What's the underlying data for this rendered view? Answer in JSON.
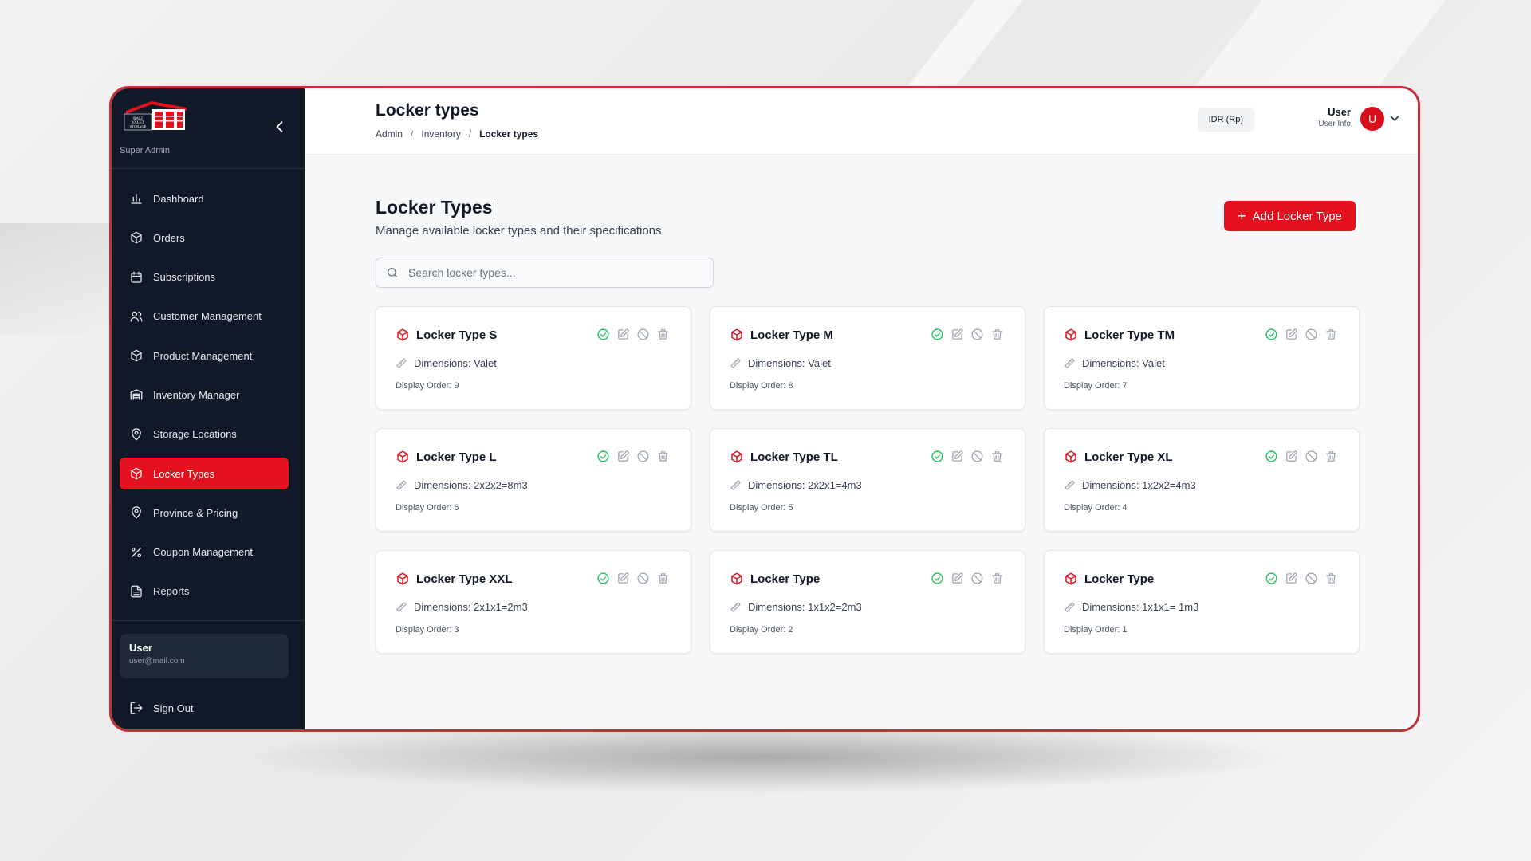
{
  "app": {
    "logo_text": "BALI VALET STORAGE",
    "role": "Super Admin"
  },
  "sidebar": {
    "items": [
      {
        "label": "Dashboard",
        "icon": "bar-chart-icon"
      },
      {
        "label": "Orders",
        "icon": "package-icon"
      },
      {
        "label": "Subscriptions",
        "icon": "calendar-icon"
      },
      {
        "label": "Customer Management",
        "icon": "users-icon"
      },
      {
        "label": "Product Management",
        "icon": "package-icon"
      },
      {
        "label": "Inventory Manager",
        "icon": "warehouse-icon"
      },
      {
        "label": "Storage Locations",
        "icon": "map-pin-icon"
      },
      {
        "label": "Locker Types",
        "icon": "package-icon"
      },
      {
        "label": "Province & Pricing",
        "icon": "map-pin-icon"
      },
      {
        "label": "Coupon Management",
        "icon": "percent-icon"
      },
      {
        "label": "Reports",
        "icon": "file-text-icon"
      }
    ],
    "active_index": 7,
    "user": {
      "name": "User",
      "email": "user@mail.com"
    },
    "signout_label": "Sign Out"
  },
  "header": {
    "title": "Locker types",
    "breadcrumb": [
      "Admin",
      "Inventory",
      "Locker types"
    ],
    "currency": "IDR (Rp)",
    "user_name": "User",
    "user_role": "User Info",
    "avatar_initial": "U"
  },
  "content": {
    "title": "Locker Types",
    "subtitle": "Manage available locker types and their specifications",
    "add_button_label": "Add Locker Type",
    "search_placeholder": "Search locker types..."
  },
  "cards": [
    {
      "name": "Locker Type S",
      "dimensions": "Dimensions: Valet",
      "order": "Display Order: 9"
    },
    {
      "name": "Locker Type M",
      "dimensions": "Dimensions: Valet",
      "order": "Display Order: 8"
    },
    {
      "name": "Locker Type TM",
      "dimensions": "Dimensions: Valet",
      "order": "Display Order: 7"
    },
    {
      "name": "Locker Type L",
      "dimensions": "Dimensions: 2x2x2=8m3",
      "order": "Display Order: 6"
    },
    {
      "name": "Locker Type TL",
      "dimensions": "Dimensions: 2x2x1=4m3",
      "order": "Display Order: 5"
    },
    {
      "name": "Locker Type XL",
      "dimensions": "Dimensions: 1x2x2=4m3",
      "order": "Display Order: 4"
    },
    {
      "name": "Locker Type XXL",
      "dimensions": "Dimensions: 2x1x1=2m3",
      "order": "Display Order: 3"
    },
    {
      "name": "Locker Type",
      "dimensions": "Dimensions: 1x1x2=2m3",
      "order": "Display Order: 2"
    },
    {
      "name": "Locker Type",
      "dimensions": "Dimensions: 1x1x1= 1m3",
      "order": "Display Order: 1"
    }
  ],
  "colors": {
    "accent": "#e3101e",
    "sidebar_bg": "#111827",
    "frame": "#c0313b",
    "active_status": "#22c55e"
  }
}
